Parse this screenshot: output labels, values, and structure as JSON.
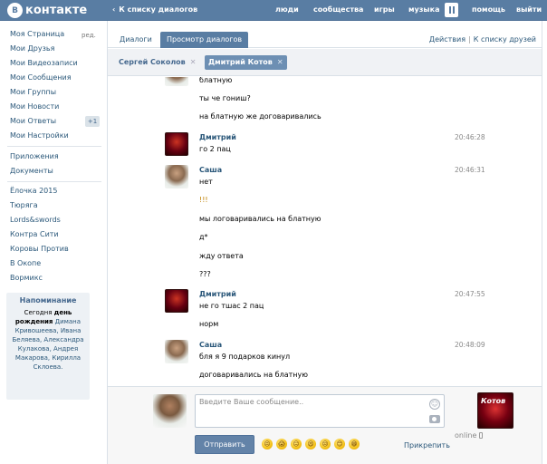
{
  "topbar": {
    "logo": "контакте",
    "logo_icon": "В",
    "back_link": "К списку диалогов",
    "nav": [
      "люди",
      "сообщества",
      "игры",
      "музыка",
      "помощь",
      "выйти"
    ]
  },
  "sidebar": {
    "edit": "ред.",
    "badge": "+1",
    "items": [
      "Моя Страница",
      "Мои Друзья",
      "Мои Видеозаписи",
      "Мои Сообщения",
      "Мои Группы",
      "Мои Новости",
      "Мои Ответы",
      "Мои Настройки",
      "Приложения",
      "Документы",
      "Ёлочка 2015",
      "Тюряга",
      "Lords&swords",
      "Контра Сити",
      "Коровы Против",
      "В Окопе",
      "Вормикс"
    ],
    "reminder": {
      "title": "Напоминание",
      "line1": "Сегодня",
      "line2": "день рождения",
      "names": "Димана Кривошеева, Ивана Беляева, Александра Кулакова, Андрея Макарова, Кирилла Склоева."
    }
  },
  "tabs": {
    "dialogs": "Диалоги",
    "view": "Просмотр диалогов",
    "actions": "Действия",
    "sep": "|",
    "to_friends": "К списку друзей"
  },
  "peers": [
    {
      "name": "Сергей Соколов",
      "close": "✕"
    },
    {
      "name": "Дмитрий Котов",
      "close": "✕"
    }
  ],
  "messages": {
    "partial_top": "блатную",
    "m0": [
      "ты че гониш?",
      "на блатную же договаривались"
    ],
    "g1": {
      "sender": "Дмитрий",
      "time": "20:46:28",
      "lines": [
        "го 2 пац"
      ]
    },
    "g2": {
      "sender": "Саша",
      "time": "20:46:31",
      "lines": [
        "нет",
        "!!!",
        "мы логоваривались на блатную",
        "д*",
        "жду ответа",
        "???"
      ]
    },
    "g3": {
      "sender": "Дмитрий",
      "time": "20:47:55",
      "lines": [
        "не го тшас 2 пац",
        "норм"
      ]
    },
    "g4": {
      "sender": "Саша",
      "time": "20:48:09",
      "lines": [
        "бля я 9 подарков кинул",
        "договаривались на блатную"
      ]
    }
  },
  "composer": {
    "placeholder": "Введите Ваше сообщение..",
    "send": "Отправить",
    "attach": "Прикрепить",
    "status": "online",
    "peer_sig": "Котов"
  },
  "colors": {
    "topbar": "#597da3",
    "link": "#2b587a",
    "button": "#6383a8"
  }
}
